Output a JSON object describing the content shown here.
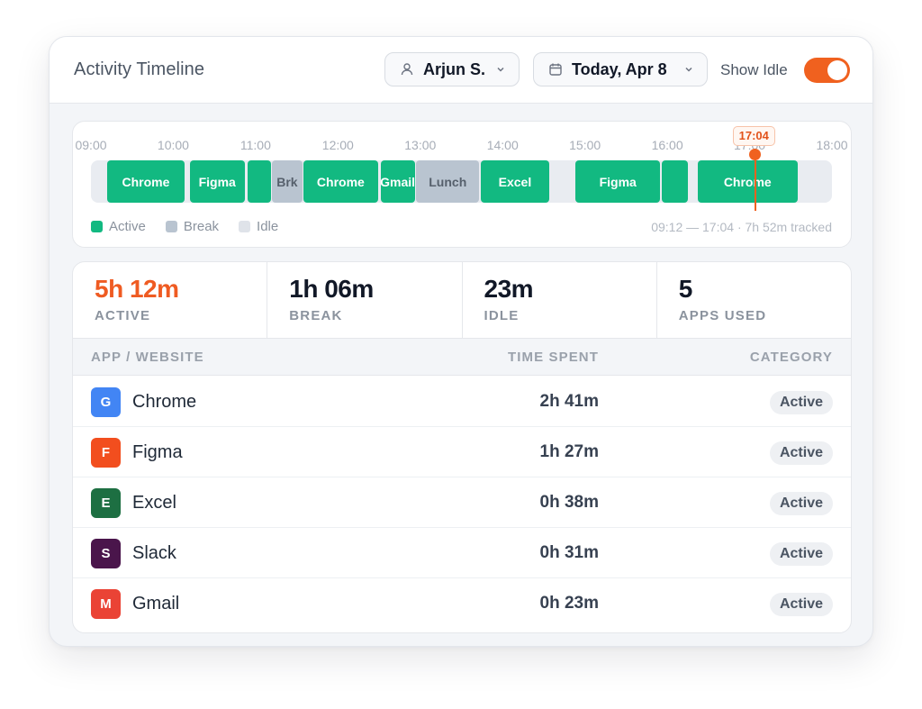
{
  "header": {
    "title": "Activity Timeline",
    "user_label": "Arjun S.",
    "date_label": "Today, Apr 8",
    "idle_label": "Show Idle",
    "idle_enabled": true
  },
  "timeline": {
    "hours": [
      "09:00",
      "10:00",
      "11:00",
      "12:00",
      "13:00",
      "14:00",
      "15:00",
      "16:00",
      "17:00",
      "18:00"
    ],
    "range": [
      "09:00",
      "18:00"
    ],
    "now_label": "17:04",
    "segments": [
      {
        "label": "Chrome",
        "type": "active",
        "start": "09:12",
        "end": "10:08"
      },
      {
        "label": "Figma",
        "type": "active",
        "start": "10:12",
        "end": "10:52"
      },
      {
        "label": "",
        "type": "active",
        "start": "10:54",
        "end": "11:11"
      },
      {
        "label": "Brk",
        "type": "break",
        "start": "11:12",
        "end": "11:34"
      },
      {
        "label": "Chrome",
        "type": "active",
        "start": "11:35",
        "end": "12:29"
      },
      {
        "label": "Gmail",
        "type": "active",
        "start": "12:31",
        "end": "12:56"
      },
      {
        "label": "Lunch",
        "type": "break",
        "start": "12:57",
        "end": "13:43"
      },
      {
        "label": "Excel",
        "type": "active",
        "start": "13:44",
        "end": "14:34"
      },
      {
        "label": "Figma",
        "type": "active",
        "start": "14:53",
        "end": "15:55"
      },
      {
        "label": "",
        "type": "active",
        "start": "15:56",
        "end": "16:15"
      },
      {
        "label": "Chrome",
        "type": "active",
        "start": "16:22",
        "end": "17:35"
      }
    ],
    "legend": [
      {
        "label": "Active",
        "color": "#12b981"
      },
      {
        "label": "Break",
        "color": "#b9c4d0"
      },
      {
        "label": "Idle",
        "color": "#dfe3e9"
      }
    ],
    "tracked_text": "09:12 — 17:04 · 7h 52m tracked"
  },
  "stats": [
    {
      "value": "5h 12m",
      "label": "ACTIVE",
      "highlight": true
    },
    {
      "value": "1h 06m",
      "label": "BREAK",
      "highlight": false
    },
    {
      "value": "23m",
      "label": "IDLE",
      "highlight": false
    },
    {
      "value": "5",
      "label": "APPS USED",
      "highlight": false
    }
  ],
  "table": {
    "columns": [
      "APP / WEBSITE",
      "TIME SPENT",
      "CATEGORY"
    ],
    "rows": [
      {
        "icon_letter": "G",
        "icon_color": "#4285f4",
        "name": "Chrome",
        "time": "2h 41m",
        "category": "Active"
      },
      {
        "icon_letter": "F",
        "icon_color": "#f24e1e",
        "name": "Figma",
        "time": "1h 27m",
        "category": "Active"
      },
      {
        "icon_letter": "E",
        "icon_color": "#1d6f42",
        "name": "Excel",
        "time": "0h 38m",
        "category": "Active"
      },
      {
        "icon_letter": "S",
        "icon_color": "#4a154b",
        "name": "Slack",
        "time": "0h 31m",
        "category": "Active"
      },
      {
        "icon_letter": "M",
        "icon_color": "#ea4335",
        "name": "Gmail",
        "time": "0h 23m",
        "category": "Active"
      }
    ]
  },
  "colors": {
    "accent": "#f0611f",
    "active": "#12b981",
    "break": "#b9c4d0"
  }
}
